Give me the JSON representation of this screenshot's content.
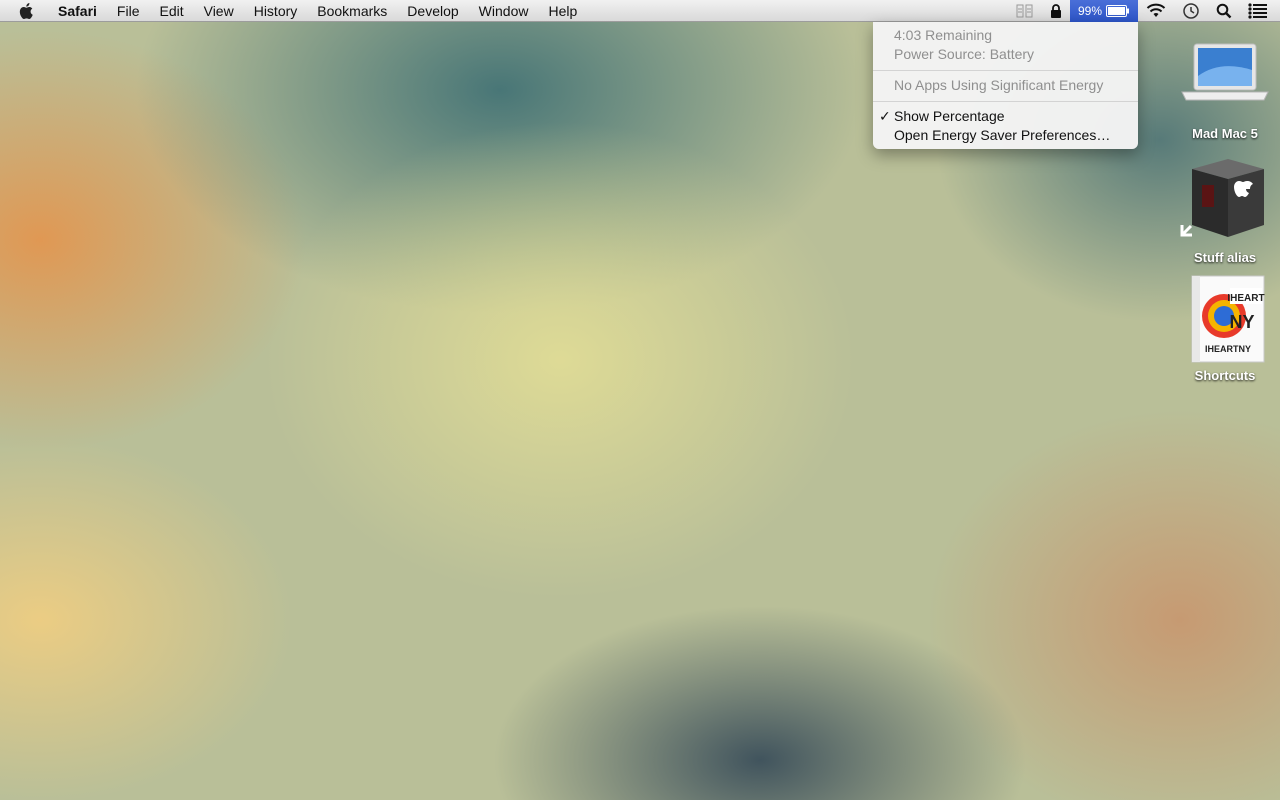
{
  "menubar": {
    "app": "Safari",
    "items": [
      "File",
      "Edit",
      "View",
      "History",
      "Bookmarks",
      "Develop",
      "Window",
      "Help"
    ],
    "battery_percent": "99%"
  },
  "battery_menu": {
    "remaining": "4:03 Remaining",
    "power_source": "Power Source: Battery",
    "energy": "No Apps Using Significant Energy",
    "check_mark": "✓",
    "show_percentage": "Show Percentage",
    "open_prefs": "Open Energy Saver Preferences…"
  },
  "desktop": {
    "icons": [
      {
        "label": "Mad Mac 5",
        "icon": "laptop-icon"
      },
      {
        "label": "Stuff alias",
        "icon": "box-icon"
      },
      {
        "label": "Shortcuts",
        "icon": "iheartny-icon"
      }
    ],
    "box_text": [
      "IHEART",
      "NY",
      "IHEARTNY"
    ]
  },
  "colors": {
    "menubar_highlight": "#2d55c8"
  }
}
